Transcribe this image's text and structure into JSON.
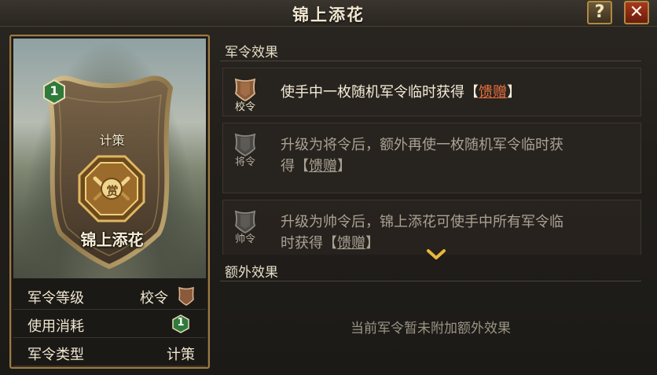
{
  "window": {
    "title": "锦上添花",
    "help_label": "?",
    "close_label": "✕"
  },
  "card": {
    "level_badge": "1",
    "type_label": "计策",
    "emblem_char": "赏",
    "name": "锦上添花",
    "info": [
      {
        "key": "军令等级",
        "value": "校令",
        "icon": "bronze-shield-icon"
      },
      {
        "key": "使用消耗",
        "value": "1",
        "icon": "green-hexagon-icon"
      },
      {
        "key": "军令类型",
        "value": "计策"
      }
    ]
  },
  "effects_section": {
    "heading": "军令效果",
    "items": [
      {
        "tier": "校令",
        "prefix": "使手中一枚随机军令临时获得【",
        "keyword": "馈赠",
        "suffix": "】",
        "active": true
      },
      {
        "tier": "将令",
        "line1": "升级为将令后，额外再使一枚随机军令临时获",
        "line2_prefix": "得【",
        "keyword": "馈赠",
        "line2_suffix": "】",
        "active": false
      },
      {
        "tier": "帅令",
        "line1": "升级为帅令后，锦上添花可使手中所有军令临",
        "line2_prefix": "时获得【",
        "keyword": "馈赠",
        "line2_suffix": "】",
        "active": false
      }
    ]
  },
  "extra_section": {
    "heading": "额外效果",
    "empty_text": "当前军令暂未附加额外效果"
  },
  "colors": {
    "accent_gold": "#b08a3e",
    "keyword_active": "#e8703e",
    "level_green": "#2f7a3a"
  }
}
